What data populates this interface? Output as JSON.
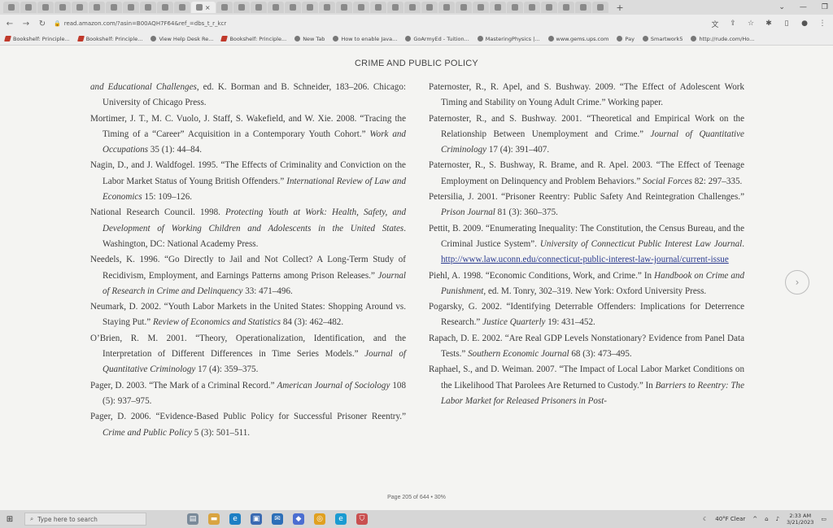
{
  "browser": {
    "tab_close": "×",
    "new_tab": "+",
    "url": "read.amazon.com/?asin=B00AQH7F64&ref_=dbs_t_r_kcr",
    "bookmarks": [
      {
        "label": "Bookshelf: Principle..."
      },
      {
        "label": "Bookshelf: Principle..."
      },
      {
        "label": "View Help Desk Re..."
      },
      {
        "label": "Bookshelf: Principle..."
      },
      {
        "label": "New Tab"
      },
      {
        "label": "How to enable Java..."
      },
      {
        "label": "GoArmyEd - Tuition..."
      },
      {
        "label": "MasteringPhysics |..."
      },
      {
        "label": "www.gems.ups.com"
      },
      {
        "label": "Pay"
      },
      {
        "label": "Smartwork5"
      },
      {
        "label": "http://rude.com/Ho..."
      }
    ]
  },
  "reader": {
    "running_head": "CRIME AND PUBLIC POLICY",
    "footer": "Page 205 of 644 • 30%",
    "next_icon": "next-page-icon"
  },
  "left_refs": [
    {
      "pre": "",
      "it": "and Educational Challenges",
      "post": ", ed. K. Borman and B. Schneider, 183–206. Chicago: University of Chicago Press."
    },
    {
      "pre": "Mortimer, J. T., M. C. Vuolo, J. Staff, S. Wakefield, and W. Xie. 2008. “Tracing the Timing of a “Career” Acquisition in a Contemporary Youth Cohort.” ",
      "it": "Work and Occupations",
      "post": " 35 (1): 44–84."
    },
    {
      "pre": "Nagin, D., and J. Waldfogel. 1995. “The Effects of Criminality and Conviction on the Labor Market Status of Young British Offenders.” ",
      "it": "International Review of Law and Economics",
      "post": " 15: 109–126."
    },
    {
      "pre": "National Research Council. 1998. ",
      "it": "Protecting Youth at Work: Health, Safety, and Development of Working Children and Adolescents in the United States",
      "post": ". Washington, DC: National Academy Press."
    },
    {
      "pre": "Needels, K. 1996. “Go Directly to Jail and Not Collect? A Long-Term Study of Recidivism, Employment, and Earnings Patterns among Prison Releases.” ",
      "it": "Journal of Research in Crime and Delinquency",
      "post": " 33: 471–496."
    },
    {
      "pre": "Neumark, D. 2002. “Youth Labor Markets in the United States: Shopping Around vs. Staying Put.” ",
      "it": "Review of Economics and Statistics",
      "post": " 84 (3): 462–482."
    },
    {
      "pre": "O’Brien, R. M. 2001. “Theory, Operationalization, Identification, and the Interpretation of Different Differences in Time Series Models.” ",
      "it": "Journal of Quantitative Criminology",
      "post": " 17 (4): 359–375."
    },
    {
      "pre": "Pager, D. 2003. “The Mark of a Criminal Record.” ",
      "it": "American Journal of Sociology",
      "post": " 108 (5): 937–975."
    },
    {
      "pre": "Pager, D. 2006. “Evidence-Based Public Policy for Successful Prisoner Reentry.” ",
      "it": "Crime and Public Policy",
      "post": " 5 (3): 501–511."
    }
  ],
  "right_refs": [
    {
      "pre": "Paternoster, R., R. Apel, and S. Bushway. 2009. “The Effect of Adolescent Work Timing and Stability on Young Adult Crime.” Working paper.",
      "it": "",
      "post": ""
    },
    {
      "pre": "Paternoster, R., and S. Bushway. 2001. “Theoretical and Empirical Work on the Relationship Between Unemployment and Crime.” ",
      "it": "Journal of Quantitative Criminology",
      "post": " 17 (4): 391–407."
    },
    {
      "pre": "Paternoster, R., S. Bushway, R. Brame, and R. Apel. 2003. “The Effect of Teenage Employment on Delinquency and Problem Behaviors.” ",
      "it": "Social Forces",
      "post": " 82: 297–335."
    },
    {
      "pre": "Petersilia, J. 2001. “Prisoner Reentry: Public Safety And Reintegration Challenges.” ",
      "it": "Prison Journal",
      "post": " 81 (3): 360–375."
    },
    {
      "pre": "Pettit, B. 2009. “Enumerating Inequality: The Constitution, the Census Bureau, and the Criminal Justice System”. ",
      "it": "University of Connecticut Public Interest Law Journal",
      "post": ". ",
      "link": "http://www.law.uconn.edu/connecticut-public-interest-law-journal/current-issue"
    },
    {
      "pre": "Piehl, A. 1998. “Economic Conditions, Work, and Crime.” In ",
      "it": "Handbook on Crime and Punishment",
      "post": ", ed. M. Tonry, 302–319. New York: Oxford University Press."
    },
    {
      "pre": "Pogarsky, G. 2002. “Identifying Deterrable Offenders: Implications for Deterrence Research.” ",
      "it": "Justice Quarterly",
      "post": " 19: 431–452."
    },
    {
      "pre": "Rapach, D. E. 2002. “Are Real GDP Levels Nonstationary? Evidence from Panel Data Tests.” ",
      "it": "Southern Economic Journal",
      "post": " 68 (3): 473–495."
    },
    {
      "pre": "Raphael, S., and D. Weiman. 2007. “The Impact of Local Labor Market Conditions on the Likelihood That Parolees Are Returned to Custody.” In ",
      "it": "Barriers to Reentry: The Labor Market for Released Prisoners in Post-",
      "post": ""
    }
  ],
  "taskbar": {
    "search_placeholder": "Type here to search",
    "weather": "40°F  Clear",
    "time": "2:33 AM",
    "date": "3/21/2023"
  }
}
